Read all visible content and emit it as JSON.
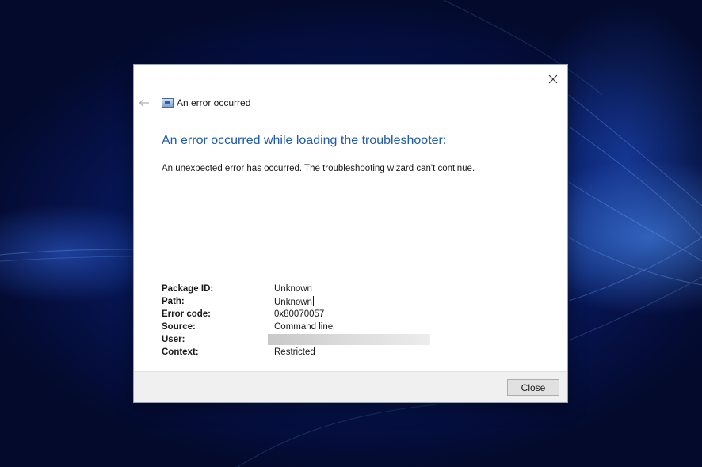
{
  "dialog": {
    "nav_title": "An error occurred",
    "heading": "An error occurred while loading the troubleshooter:",
    "message": "An unexpected error has occurred. The troubleshooting wizard can't continue.",
    "close_button_label": "Close",
    "icons": {
      "close": "close-icon",
      "back": "back-arrow-icon",
      "app": "troubleshooter-icon"
    }
  },
  "details": {
    "package_id": {
      "label": "Package ID:",
      "value": "Unknown"
    },
    "path": {
      "label": "Path:",
      "value": "Unknown"
    },
    "error_code": {
      "label": "Error code:",
      "value": "0x80070057"
    },
    "source": {
      "label": "Source:",
      "value": "Command line"
    },
    "user": {
      "label": "User:",
      "value": ""
    },
    "context": {
      "label": "Context:",
      "value": "Restricted"
    }
  },
  "colors": {
    "heading": "#1e5aa8",
    "footer": "#f0f0f0",
    "wallpaper": "#071c66"
  }
}
